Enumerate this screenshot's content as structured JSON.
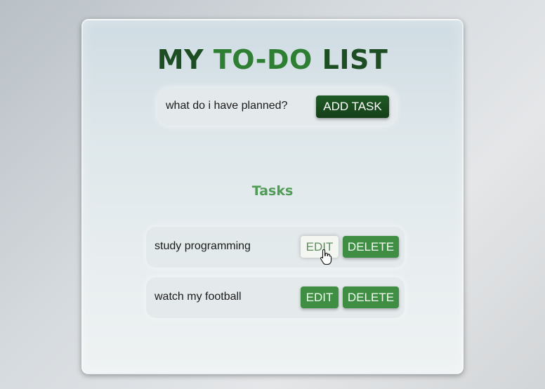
{
  "app": {
    "title_part1": "MY ",
    "title_part2": "TO-DO",
    "title_part3": " LIST"
  },
  "input": {
    "placeholder": "what do i have planned?",
    "value": ""
  },
  "add_button": {
    "label": "ADD TASK"
  },
  "tasks_heading": "Tasks",
  "tasks": [
    {
      "text": "study programming",
      "edit_label": "EDIT",
      "delete_label": "DELETE",
      "edit_hovered": true
    },
    {
      "text": "watch my football",
      "edit_label": "EDIT",
      "delete_label": "DELETE",
      "edit_hovered": false
    }
  ],
  "colors": {
    "title_dark": "#1d4d22",
    "title_accent": "#2e7f33",
    "button_dark": "#1f5a25",
    "button_green": "#3f8e44",
    "heading_green": "#4f9c55"
  },
  "icons": {
    "cursor": "hand-pointer-icon"
  }
}
